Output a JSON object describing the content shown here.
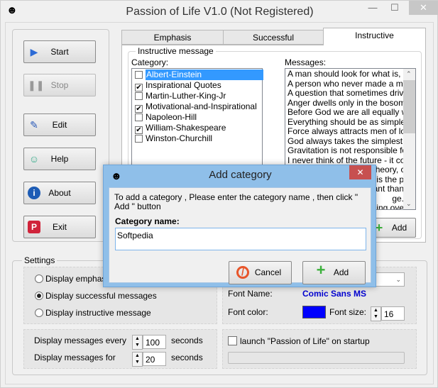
{
  "window": {
    "title": "Passion of Life V1.0 (Not Registered)",
    "minimize": "—",
    "maximize": "☐",
    "close": "✕"
  },
  "sidebar": {
    "buttons": [
      {
        "label": "Start",
        "icon": "play-icon"
      },
      {
        "label": "Stop",
        "icon": "pause-icon",
        "disabled": true
      },
      {
        "label": "Edit",
        "icon": "edit-icon"
      },
      {
        "label": "Help",
        "icon": "help-icon"
      },
      {
        "label": "About",
        "icon": "info-icon"
      },
      {
        "label": "Exit",
        "icon": "exit-icon"
      }
    ]
  },
  "tabs": [
    {
      "label": "Emphasis"
    },
    {
      "label": "Successful"
    },
    {
      "label": "Instructive",
      "active": true
    }
  ],
  "instructive": {
    "group_label": "Instructive message",
    "category_label": "Category:",
    "messages_label": "Messages:",
    "add_label": "Add",
    "categories": [
      {
        "label": "Albert-Einstein",
        "checked": false,
        "selected": true
      },
      {
        "label": "Inspirational Quotes",
        "checked": true
      },
      {
        "label": "Martin-Luther-King-Jr",
        "checked": false
      },
      {
        "label": "Motivational-and-Inspirational",
        "checked": true
      },
      {
        "label": "Napoleon-Hill",
        "checked": false
      },
      {
        "label": "William-Shakespeare",
        "checked": true
      },
      {
        "label": "Winston-Churchill",
        "checked": false
      }
    ],
    "messages": [
      "A man should look for what is, and",
      "A person who never made a mistal",
      "A question that sometimes drives m",
      "Anger dwells only in the bosom of f",
      "Before God we are all equally wise",
      "Everything should be as simple as",
      "Force always attracts men of low m",
      "God always takes the simplest way",
      "Gravitation is not responsible for pe",
      "I never think of the future - it come",
      "If the facts don't fit the theory, cha"
    ],
    "messages_partial": [
      "t is the p",
      "ant than",
      "ge.",
      "ing ove"
    ]
  },
  "settings": {
    "group_label": "Settings",
    "radios": [
      {
        "label": "Display emphasis",
        "checked": false
      },
      {
        "label": "Display successful messages",
        "checked": true
      },
      {
        "label": "Display instructive message",
        "checked": false
      }
    ],
    "font_name_label": "Font Name:",
    "font_name_value": "Comic Sans MS",
    "font_color_label": "Font color:",
    "font_color": "#0000ff",
    "font_size_label": "Font size:",
    "font_size": "16",
    "every_label": "Display messages every",
    "every_value": "100",
    "for_label": "Display messages for",
    "for_value": "20",
    "seconds": "seconds",
    "startup_label": "launch \"Passion of Life\" on startup",
    "startup_checked": false
  },
  "dialog": {
    "title": "Add category",
    "instructions": "To add a category , Please enter the category name , then click \" Add \" button",
    "field_label": "Category name:",
    "field_value": "Softpedia",
    "cancel_label": "Cancel",
    "add_label": "Add",
    "close": "✕"
  }
}
